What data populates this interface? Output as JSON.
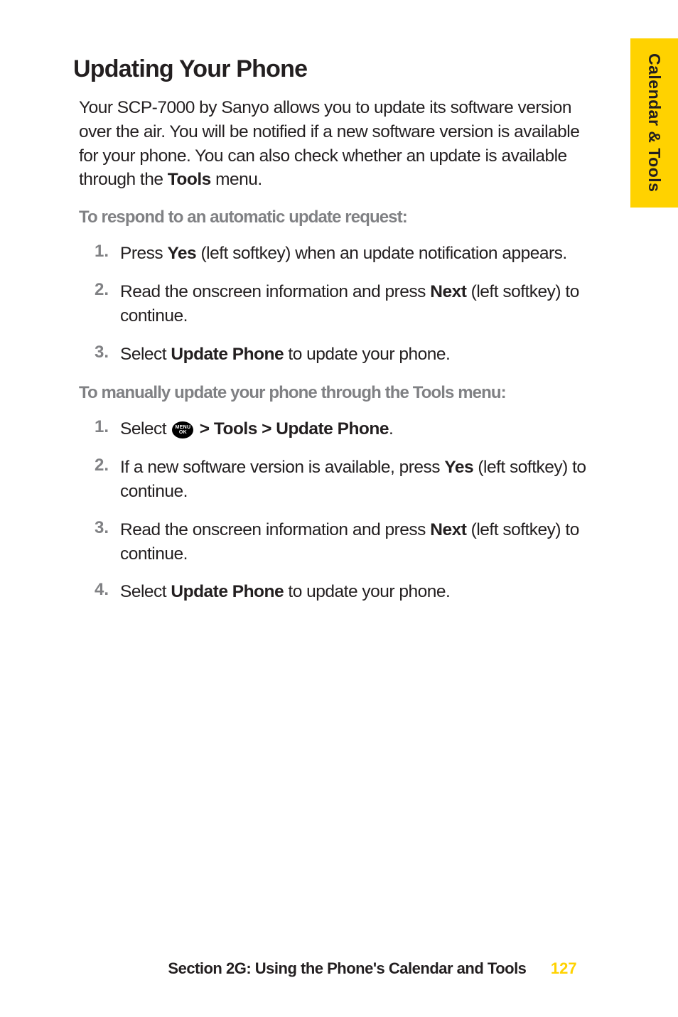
{
  "side_tab": "Calendar & Tools",
  "heading": "Updating Your Phone",
  "intro_part1": "Your SCP-7000 by Sanyo allows you to update its software version over the air. You will be notified if a new software version is available for your phone. You can also check whether an update is available through the ",
  "intro_bold_tools": "Tools",
  "intro_part2": " menu.",
  "subhead1": "To respond to an automatic update request:",
  "list1": {
    "item1": {
      "num": "1.",
      "t1": "Press ",
      "b1": "Yes",
      "t2": " (left softkey) when an update notification appears."
    },
    "item2": {
      "num": "2.",
      "t1": "Read the onscreen information and press ",
      "b1": "Next",
      "t2": " (left softkey) to continue."
    },
    "item3": {
      "num": "3.",
      "t1": "Select ",
      "b1": "Update Phone",
      "t2": " to update your phone."
    }
  },
  "subhead2": "To manually update your phone through the Tools menu:",
  "list2": {
    "item1": {
      "num": "1.",
      "t1": "Select ",
      "icon_top": "MENU",
      "icon_bottom": "OK",
      "b1": " > Tools > Update Phone",
      "t2": "."
    },
    "item2": {
      "num": "2.",
      "t1": "If a new software version is available, press ",
      "b1": "Yes",
      "t2": " (left softkey) to continue."
    },
    "item3": {
      "num": "3.",
      "t1": "Read the onscreen information and press ",
      "b1": "Next",
      "t2": " (left softkey) to continue."
    },
    "item4": {
      "num": "4.",
      "t1": "Select ",
      "b1": "Update Phone",
      "t2": " to update your phone."
    }
  },
  "footer_text": "Section 2G: Using the Phone's Calendar and Tools",
  "page_num": "127"
}
